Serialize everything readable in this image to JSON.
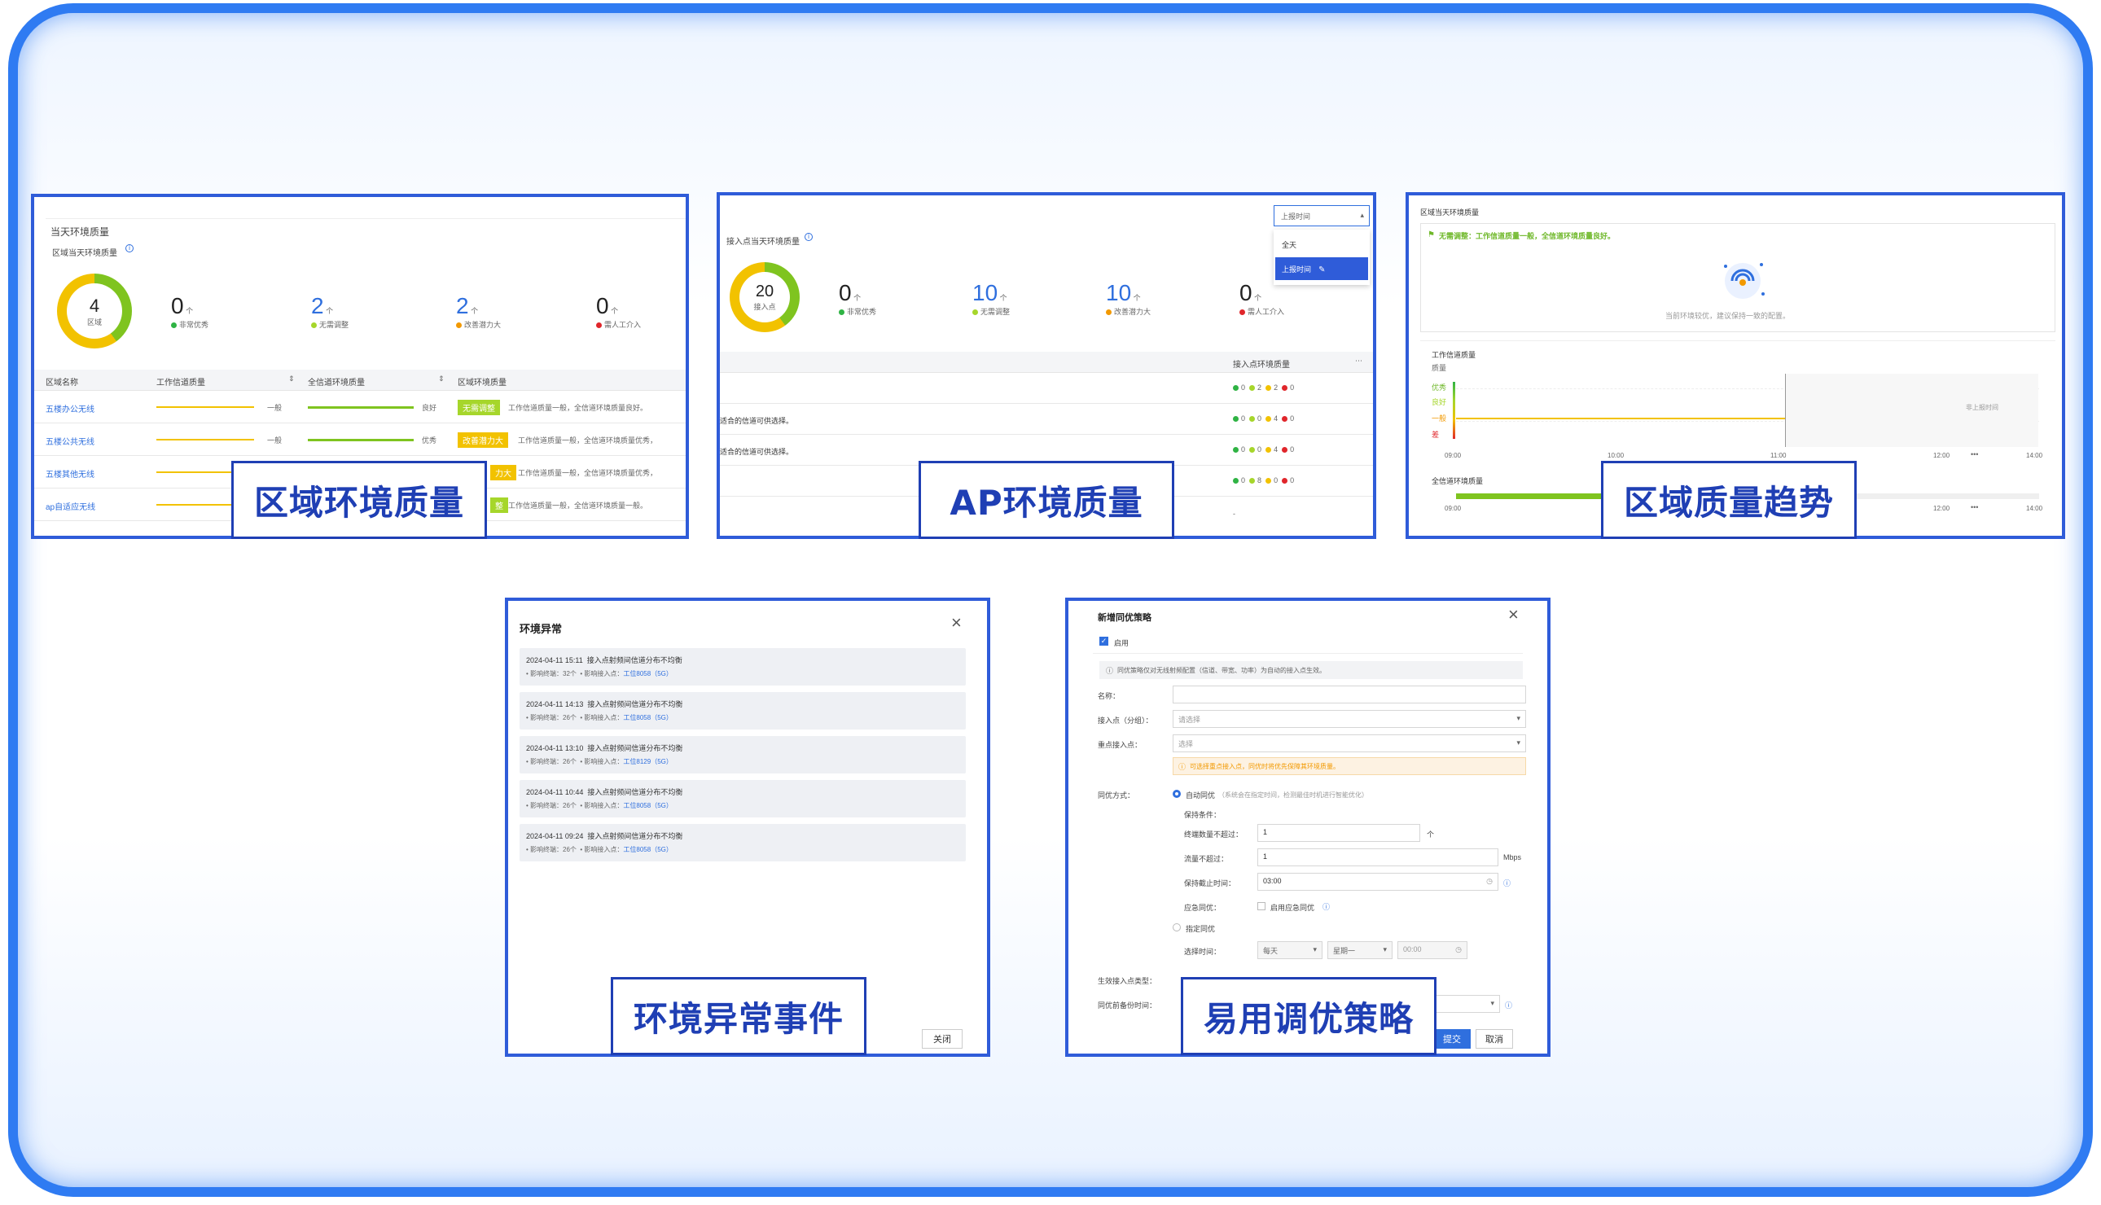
{
  "captions": {
    "region_quality": "区域环境质量",
    "ap_quality": "AP环境质量",
    "region_trend": "区域质量趋势",
    "env_events": "环境异常事件",
    "tuning_policy": "易用调优策略"
  },
  "region_card": {
    "header": "当天环境质量",
    "subheader": "区域当天环境质量",
    "ring_value": "4",
    "ring_label": "区域",
    "stats": [
      {
        "value": "0",
        "label": "非常优秀",
        "color": "#2fb344"
      },
      {
        "value": "2",
        "label": "无需调整",
        "color": "#a6d62b"
      },
      {
        "value": "2",
        "label": "改善潜力大",
        "color": "#f29900"
      },
      {
        "value": "0",
        "label": "需人工介入",
        "color": "#e0262b"
      }
    ],
    "columns": [
      "区域名称",
      "工作信道质量",
      "全信道环境质量",
      "区域环境质量"
    ],
    "rows": [
      {
        "name": "五楼办公无线",
        "work": "一般",
        "all": "良好",
        "badge": "无需调整",
        "badge_color": "#a6d62b",
        "desc": "工作信道质量一般，全信道环境质量良好。"
      },
      {
        "name": "五楼公共无线",
        "work": "一般",
        "all": "优秀",
        "badge": "改善潜力大",
        "badge_color": "#f2c200",
        "desc": "工作信道质量一般，全信道环境质量优秀，"
      },
      {
        "name": "五楼其他无线",
        "work": "",
        "all": "",
        "badge": "力大",
        "badge_color": "#f2c200",
        "desc": "工作信道质量一般，全信道环境质量优秀，"
      },
      {
        "name": "ap自适应无线",
        "work": "",
        "all": "",
        "badge": "整",
        "badge_color": "#a6d62b",
        "desc": "工作信道质量一般，全信道环境质量一般。"
      }
    ]
  },
  "ap_card": {
    "select_value": "上报时间",
    "dropdown": [
      "全天",
      "上报时间"
    ],
    "subheader": "接入点当天环境质量",
    "ring_value": "20",
    "ring_label": "接入点",
    "stats": [
      {
        "value": "0",
        "label": "非常优秀",
        "color": "#2fb344"
      },
      {
        "value": "10",
        "label": "无需调整",
        "color": "#a6d62b"
      },
      {
        "value": "10",
        "label": "改善潜力大",
        "color": "#f29900"
      },
      {
        "value": "0",
        "label": "需人工介入",
        "color": "#e0262b"
      }
    ],
    "column": "接入点环境质量",
    "rows": [
      {
        "text": "",
        "counts": [
          "0",
          "2",
          "2",
          "0"
        ]
      },
      {
        "text": "适合的信道可供选择。",
        "counts": [
          "0",
          "0",
          "4",
          "0"
        ]
      },
      {
        "text": "适合的信道可供选择。",
        "counts": [
          "0",
          "0",
          "4",
          "0"
        ]
      },
      {
        "text": "",
        "counts": [
          "0",
          "8",
          "0",
          "0"
        ]
      }
    ],
    "last_cell": "-"
  },
  "trend_card": {
    "header": "区域当天环境质量",
    "status": "无需调整：工作信道质量一般，全信道环境质量良好。",
    "status_hint": "当前环境较优，建议保持一致的配置。",
    "chart1_title": "工作信道质量",
    "chart1_axis": "质量",
    "y_labels": [
      "优秀",
      "良好",
      "一般",
      "差"
    ],
    "x_labels": [
      "09:00",
      "10:00",
      "11:00",
      "12:00",
      "14:00"
    ],
    "marker_label": "非上报时间",
    "chart2_title": "全信道环境质量",
    "x2_labels": [
      "09:00",
      "12:00",
      "14:00"
    ]
  },
  "events_card": {
    "title": "环境异常",
    "events": [
      {
        "time": "2024-04-11 15:11",
        "title": "接入点射频间信道分布不均衡",
        "count_label": "影响终端：",
        "count": "32个",
        "ap_label": "影响接入点：",
        "ap": "工位8058（5G）"
      },
      {
        "time": "2024-04-11 14:13",
        "title": "接入点射频间信道分布不均衡",
        "count_label": "影响终端：",
        "count": "26个",
        "ap_label": "影响接入点：",
        "ap": "工位8058（5G）"
      },
      {
        "time": "2024-04-11 13:10",
        "title": "接入点射频间信道分布不均衡",
        "count_label": "影响终端：",
        "count": "26个",
        "ap_label": "影响接入点：",
        "ap": "工位8129（5G）"
      },
      {
        "time": "2024-04-11 10:44",
        "title": "接入点射频间信道分布不均衡",
        "count_label": "影响终端：",
        "count": "26个",
        "ap_label": "影响接入点：",
        "ap": "工位8058（5G）"
      },
      {
        "time": "2024-04-11 09:24",
        "title": "接入点射频间信道分布不均衡",
        "count_label": "影响终端：",
        "count": "26个",
        "ap_label": "影响接入点：",
        "ap": "工位8058（5G）"
      }
    ],
    "close_button": "关闭"
  },
  "policy_card": {
    "title": "新增同优策略",
    "enable_label": "启用",
    "info": "同优策略仅对无线射频配置（信道、带宽、功率）为自动的接入点生效。",
    "name_label": "名称：",
    "ap_label": "接入点（分组）：",
    "ap_placeholder": "请选择",
    "key_label": "重点接入点：",
    "key_placeholder": "选择",
    "warning": "可选择重点接入点，同优时将优先保障其环境质量。",
    "mode_label": "同优方式：",
    "mode_auto": "自动同优",
    "mode_auto_hint": "（系统会在指定时间，检测最佳时机进行智能优化）",
    "trigger_label": "保持条件：",
    "clients_label": "终端数量不超过：",
    "clients_value": "1",
    "clients_unit": "个",
    "traffic_label": "流量不超过：",
    "traffic_value": "1",
    "traffic_unit": "Mbps",
    "deadline_label": "保持截止时间：",
    "deadline_value": "03:00",
    "emergency_label": "应急同优：",
    "emergency_check": "启用应急同优",
    "mode_manual": "指定同优",
    "time_label": "选择时间：",
    "time_day": "每天",
    "time_week": "星期一",
    "time_value": "00:00",
    "effect_label": "生效接入点类型：",
    "backup_label": "同优前备份时间：",
    "submit": "提交",
    "cancel": "取消"
  }
}
